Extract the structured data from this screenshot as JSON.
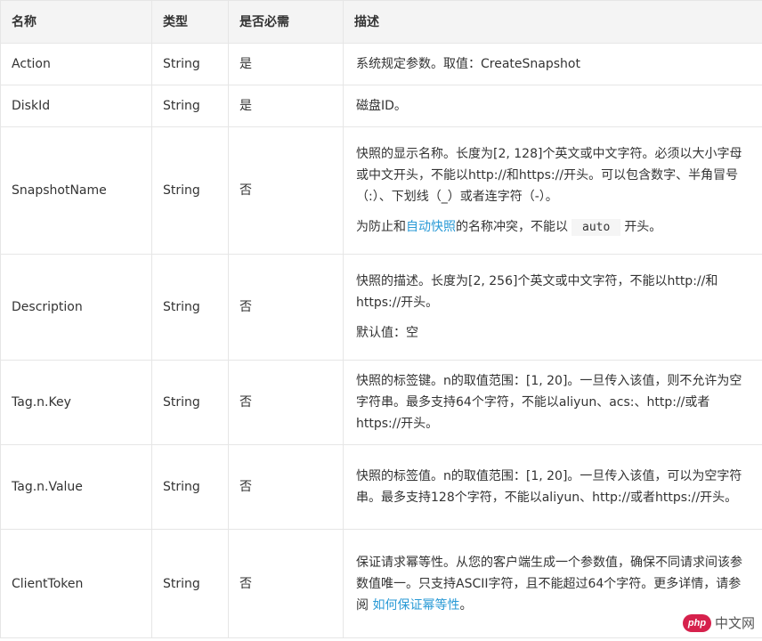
{
  "header": {
    "col_name": "名称",
    "col_type": "类型",
    "col_required": "是否必需",
    "col_desc": "描述"
  },
  "rows": [
    {
      "name": "Action",
      "type": "String",
      "required": "是",
      "desc_text": "系统规定参数。取值：CreateSnapshot"
    },
    {
      "name": "DiskId",
      "type": "String",
      "required": "是",
      "desc_text": "磁盘ID。"
    },
    {
      "name": "SnapshotName",
      "type": "String",
      "required": "否",
      "desc_p1": "快照的显示名称。长度为[2, 128]个英文或中文字符。必须以大小字母或中文开头，不能以http://和https://开头。可以包含数字、半角冒号（:）、下划线（_）或者连字符（-）。",
      "desc_p2_before": "为防止和",
      "desc_p2_link": "自动快照",
      "desc_p2_mid": "的名称冲突，不能以",
      "desc_p2_code": "auto",
      "desc_p2_after": "开头。"
    },
    {
      "name": "Description",
      "type": "String",
      "required": "否",
      "desc_p1": "快照的描述。长度为[2, 256]个英文或中文字符，不能以http://和https://开头。",
      "desc_p2": "默认值：空"
    },
    {
      "name": "Tag.n.Key",
      "type": "String",
      "required": "否",
      "desc_text": "快照的标签键。n的取值范围：[1, 20]。一旦传入该值，则不允许为空字符串。最多支持64个字符，不能以aliyun、acs:、http://或者https://开头。"
    },
    {
      "name": "Tag.n.Value",
      "type": "String",
      "required": "否",
      "desc_text": "快照的标签值。n的取值范围：[1, 20]。一旦传入该值，可以为空字符串。最多支持128个字符，不能以aliyun、http://或者https://开头。"
    },
    {
      "name": "ClientToken",
      "type": "String",
      "required": "否",
      "desc_before": "保证请求幂等性。从您的客户端生成一个参数值，确保不同请求间该参数值唯一。只支持ASCII字符，且不能超过64个字符。更多详情，请参阅",
      "desc_link": "如何保证幂等性",
      "desc_after": "。"
    }
  ],
  "watermark": {
    "icon_text": "php",
    "label": "中文网"
  },
  "colors": {
    "header_bg": "#f4f4f4",
    "border": "#e6e6e6",
    "link": "#2a9ad6",
    "text": "#333333"
  }
}
